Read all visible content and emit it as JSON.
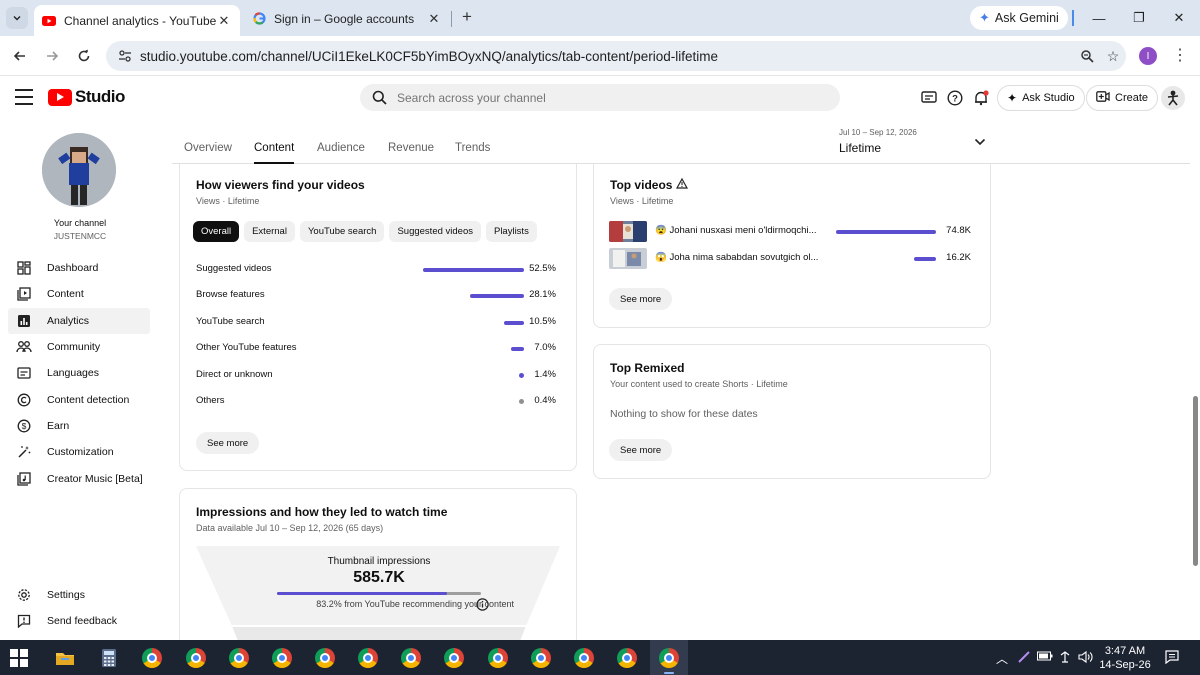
{
  "browser": {
    "tabs": [
      {
        "title": "Channel analytics - YouTube Stu",
        "icon": "youtube-icon"
      },
      {
        "title": "Sign in – Google accounts",
        "icon": "google-icon"
      }
    ],
    "gemini_label": "Ask Gemini",
    "url": "studio.youtube.com/channel/UCiI1EkeLK0CF5bYimBOyxNQ/analytics/tab-content/period-lifetime",
    "profile_initial": "I"
  },
  "studio": {
    "logo_text": "Studio",
    "search_placeholder": "Search across your channel",
    "ask_studio": "Ask Studio",
    "create": "Create"
  },
  "sidebar": {
    "channel_label": "Your channel",
    "channel_name": "JUSTENMCC",
    "items": [
      {
        "label": "Dashboard",
        "icon": "dashboard-icon"
      },
      {
        "label": "Content",
        "icon": "content-icon"
      },
      {
        "label": "Analytics",
        "icon": "analytics-icon"
      },
      {
        "label": "Community",
        "icon": "community-icon"
      },
      {
        "label": "Languages",
        "icon": "languages-icon"
      },
      {
        "label": "Content detection",
        "icon": "content-detection-icon"
      },
      {
        "label": "Earn",
        "icon": "earn-icon"
      },
      {
        "label": "Customization",
        "icon": "customization-icon"
      },
      {
        "label": "Creator Music [Beta]",
        "icon": "creator-music-icon"
      }
    ],
    "settings": "Settings",
    "feedback": "Send feedback"
  },
  "tabs": [
    "Overview",
    "Content",
    "Audience",
    "Revenue",
    "Trends"
  ],
  "period": {
    "dates": "Jul 10 – Sep 12, 2026",
    "value": "Lifetime"
  },
  "viewers_card": {
    "title": "How viewers find your videos",
    "subtitle": "Views · Lifetime",
    "chips": [
      "Overall",
      "External",
      "YouTube search",
      "Suggested videos",
      "Playlists"
    ],
    "sources": [
      {
        "label": "Suggested videos",
        "pct": "52.5%",
        "value": 52.5
      },
      {
        "label": "Browse features",
        "pct": "28.1%",
        "value": 28.1
      },
      {
        "label": "YouTube search",
        "pct": "10.5%",
        "value": 10.5
      },
      {
        "label": "Other YouTube features",
        "pct": "7.0%",
        "value": 7.0
      },
      {
        "label": "Direct or unknown",
        "pct": "1.4%",
        "value": 1.4
      },
      {
        "label": "Others",
        "pct": "0.4%",
        "value": 0.4
      }
    ],
    "see_more": "See more"
  },
  "top_videos": {
    "title": "Top videos",
    "subtitle": "Views · Lifetime",
    "videos": [
      {
        "title": "😨 Johani nusxasi meni o'ldirmoqchi...",
        "views": "74.8K",
        "value": 74.8
      },
      {
        "title": "😱 Joha nima sababdan sovutgich ol...",
        "views": "16.2K",
        "value": 16.2
      }
    ],
    "see_more": "See more"
  },
  "top_remixed": {
    "title": "Top Remixed",
    "subtitle": "Your content used to create Shorts · Lifetime",
    "empty": "Nothing to show for these dates",
    "see_more": "See more"
  },
  "impressions": {
    "title": "Impressions and how they led to watch time",
    "subtitle": "Data available Jul 10 – Sep 12, 2026 (65 days)",
    "label": "Thumbnail impressions",
    "value": "585.7K",
    "recommend_pct": 83.2,
    "note": "83.2% from YouTube recommending your content"
  },
  "taskbar": {
    "time": "3:47 AM",
    "date": "14-Sep-26"
  },
  "colors": {
    "accent": "#5b4fcf",
    "brand": "#ff0000"
  }
}
